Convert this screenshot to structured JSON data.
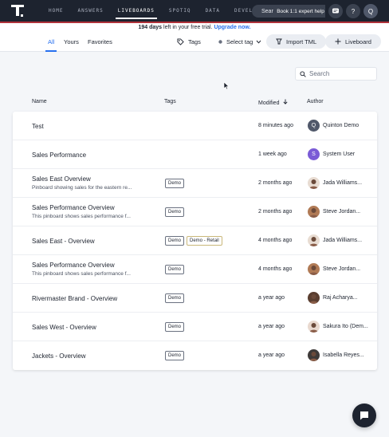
{
  "nav": {
    "items": [
      "HOME",
      "ANSWERS",
      "LIVEBOARDS",
      "SPOTIQ",
      "DATA",
      "DEVELOP"
    ],
    "active_index": 2,
    "search_text": "Sear",
    "expert_help": "Book 1:1 expert help",
    "help_glyph": "?",
    "user_initial": "Q",
    "icons": [
      "thoughtspot-logo-icon",
      "chat-bubble-icon",
      "help-icon"
    ]
  },
  "banner": {
    "days": "194 days",
    "text": " left in your free trial. ",
    "link": "Upgrade now."
  },
  "tabs": {
    "all": "All",
    "yours": "Yours",
    "favorites": "Favorites"
  },
  "toolbar": {
    "tags": "Tags",
    "select_tag": "Select tag",
    "import_tml": "Import TML",
    "liveboard": "Liveboard"
  },
  "search": {
    "placeholder": "Search"
  },
  "columns": {
    "name": "Name",
    "tags": "Tags",
    "modified": "Modified",
    "author": "Author"
  },
  "rows": [
    {
      "name": "Test",
      "desc": "",
      "tags": [],
      "modified": "8 minutes ago",
      "author": "Quinton Demo",
      "avatar": "Q",
      "avatar_color": "#50586a"
    },
    {
      "name": "Sales Performance",
      "desc": "",
      "tags": [],
      "modified": "1 week ago",
      "author": "System User",
      "avatar": "S",
      "avatar_color": "#7a5bd6"
    },
    {
      "name": "Sales East Overview",
      "desc": "Pinboard showing sales for the eastern re...",
      "tags": [
        "Demo"
      ],
      "modified": "2 months ago",
      "author": "Jada Williams...",
      "avatar": "",
      "avatar_color": "#e8dcd2"
    },
    {
      "name": "Sales Performance Overview",
      "desc": "This pinboard shows sales performance f...",
      "tags": [
        "Demo"
      ],
      "modified": "2 months ago",
      "author": "Steve Jordan...",
      "avatar": "",
      "avatar_color": "#b07a55"
    },
    {
      "name": "Sales East - Overview",
      "desc": "",
      "tags": [
        "Demo",
        "Demo - Retail"
      ],
      "modified": "4 months ago",
      "author": "Jada Williams...",
      "avatar": "",
      "avatar_color": "#e8dcd2"
    },
    {
      "name": "Sales Performance Overview",
      "desc": "This pinboard shows sales performance f...",
      "tags": [
        "Demo"
      ],
      "modified": "4 months ago",
      "author": "Steve Jordan...",
      "avatar": "",
      "avatar_color": "#b07a55"
    },
    {
      "name": "Rivermaster Brand - Overview",
      "desc": "",
      "tags": [
        "Demo"
      ],
      "modified": "a year ago",
      "author": "Raj Acharya...",
      "avatar": "",
      "avatar_color": "#5a3e30"
    },
    {
      "name": "Sales West - Overview",
      "desc": "",
      "tags": [
        "Demo"
      ],
      "modified": "a year ago",
      "author": "Sakura Ito (Dem...",
      "avatar": "",
      "avatar_color": "#e9d9cf"
    },
    {
      "name": "Jackets - Overview",
      "desc": "",
      "tags": [
        "Demo"
      ],
      "modified": "a year ago",
      "author": "Isabella Reyes...",
      "avatar": "",
      "avatar_color": "#3e3a38"
    }
  ]
}
